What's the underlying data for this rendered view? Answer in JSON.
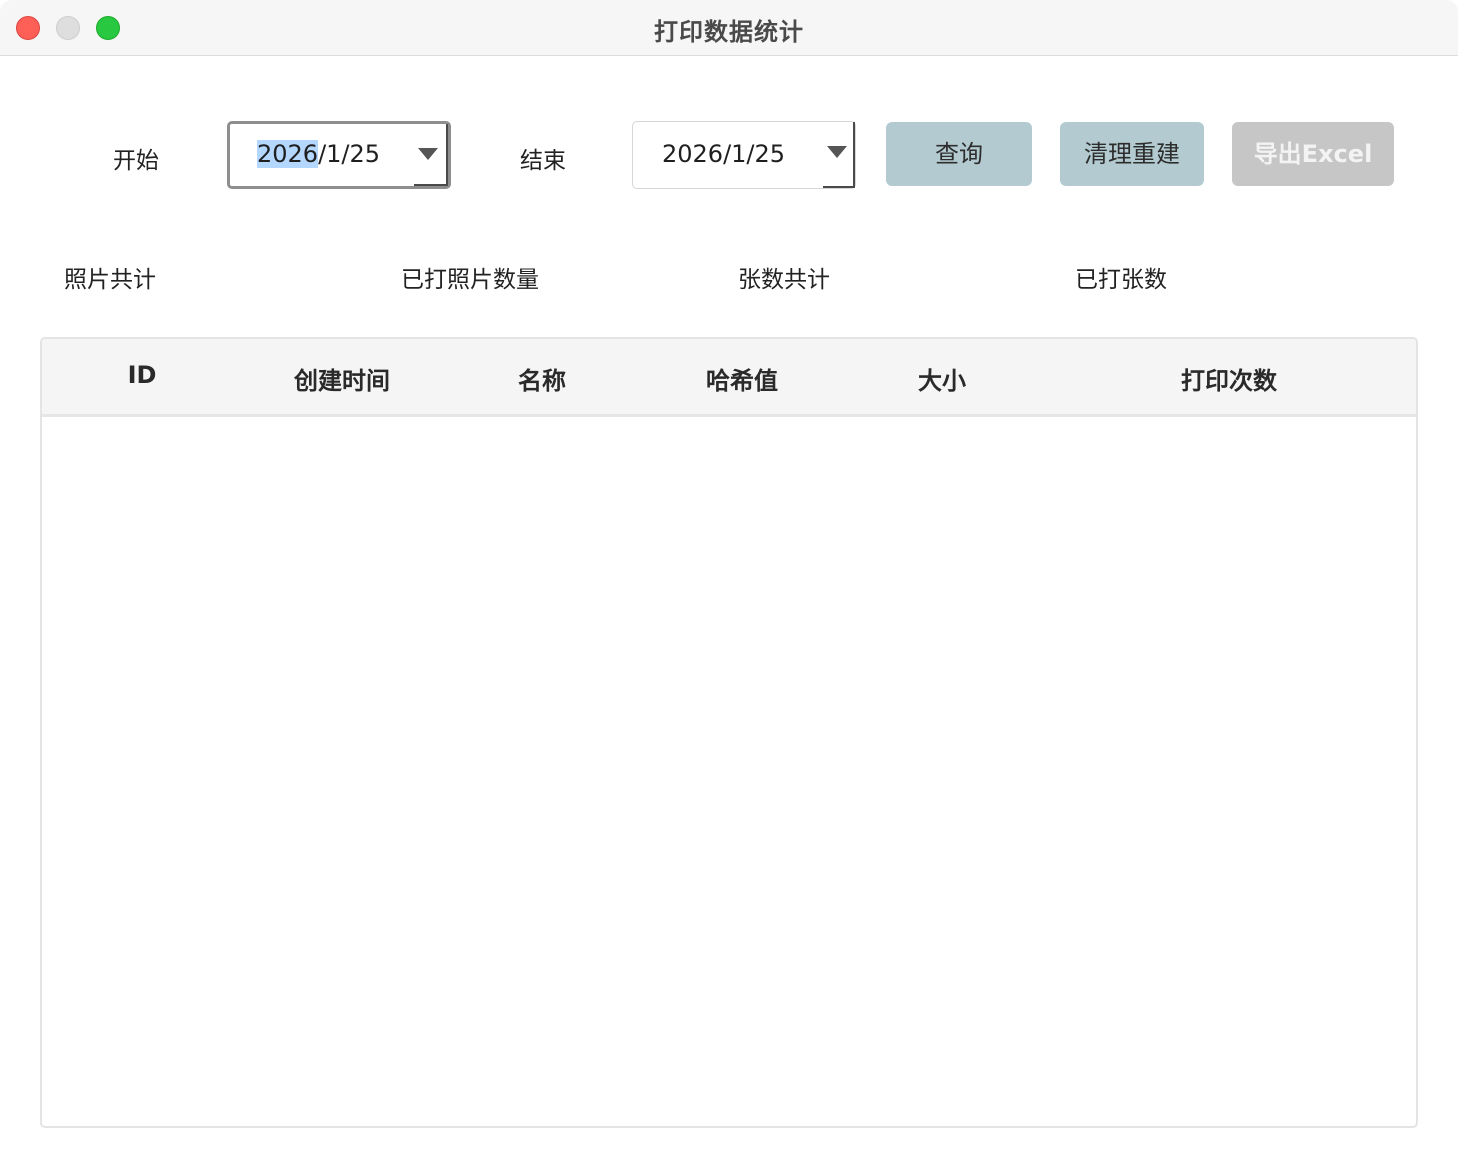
{
  "window": {
    "title": "打印数据统计"
  },
  "filters": {
    "start_label": "开始",
    "start_date_selected": "2026",
    "start_date_rest": "/1/25",
    "end_label": "结束",
    "end_date": "2026/1/25"
  },
  "buttons": {
    "query": "查询",
    "rebuild": "清理重建",
    "export": "导出Excel"
  },
  "stats": {
    "photos_total": "照片共计",
    "photos_printed": "已打照片数量",
    "sheets_total": "张数共计",
    "sheets_printed": "已打张数"
  },
  "table": {
    "columns": [
      "ID",
      "创建时间",
      "名称",
      "哈希值",
      "大小",
      "打印次数"
    ],
    "rows": []
  },
  "colors": {
    "primary_button": "#b3cbd0",
    "disabled_button": "#c6c6c6",
    "selection": "#b3d7ff"
  }
}
